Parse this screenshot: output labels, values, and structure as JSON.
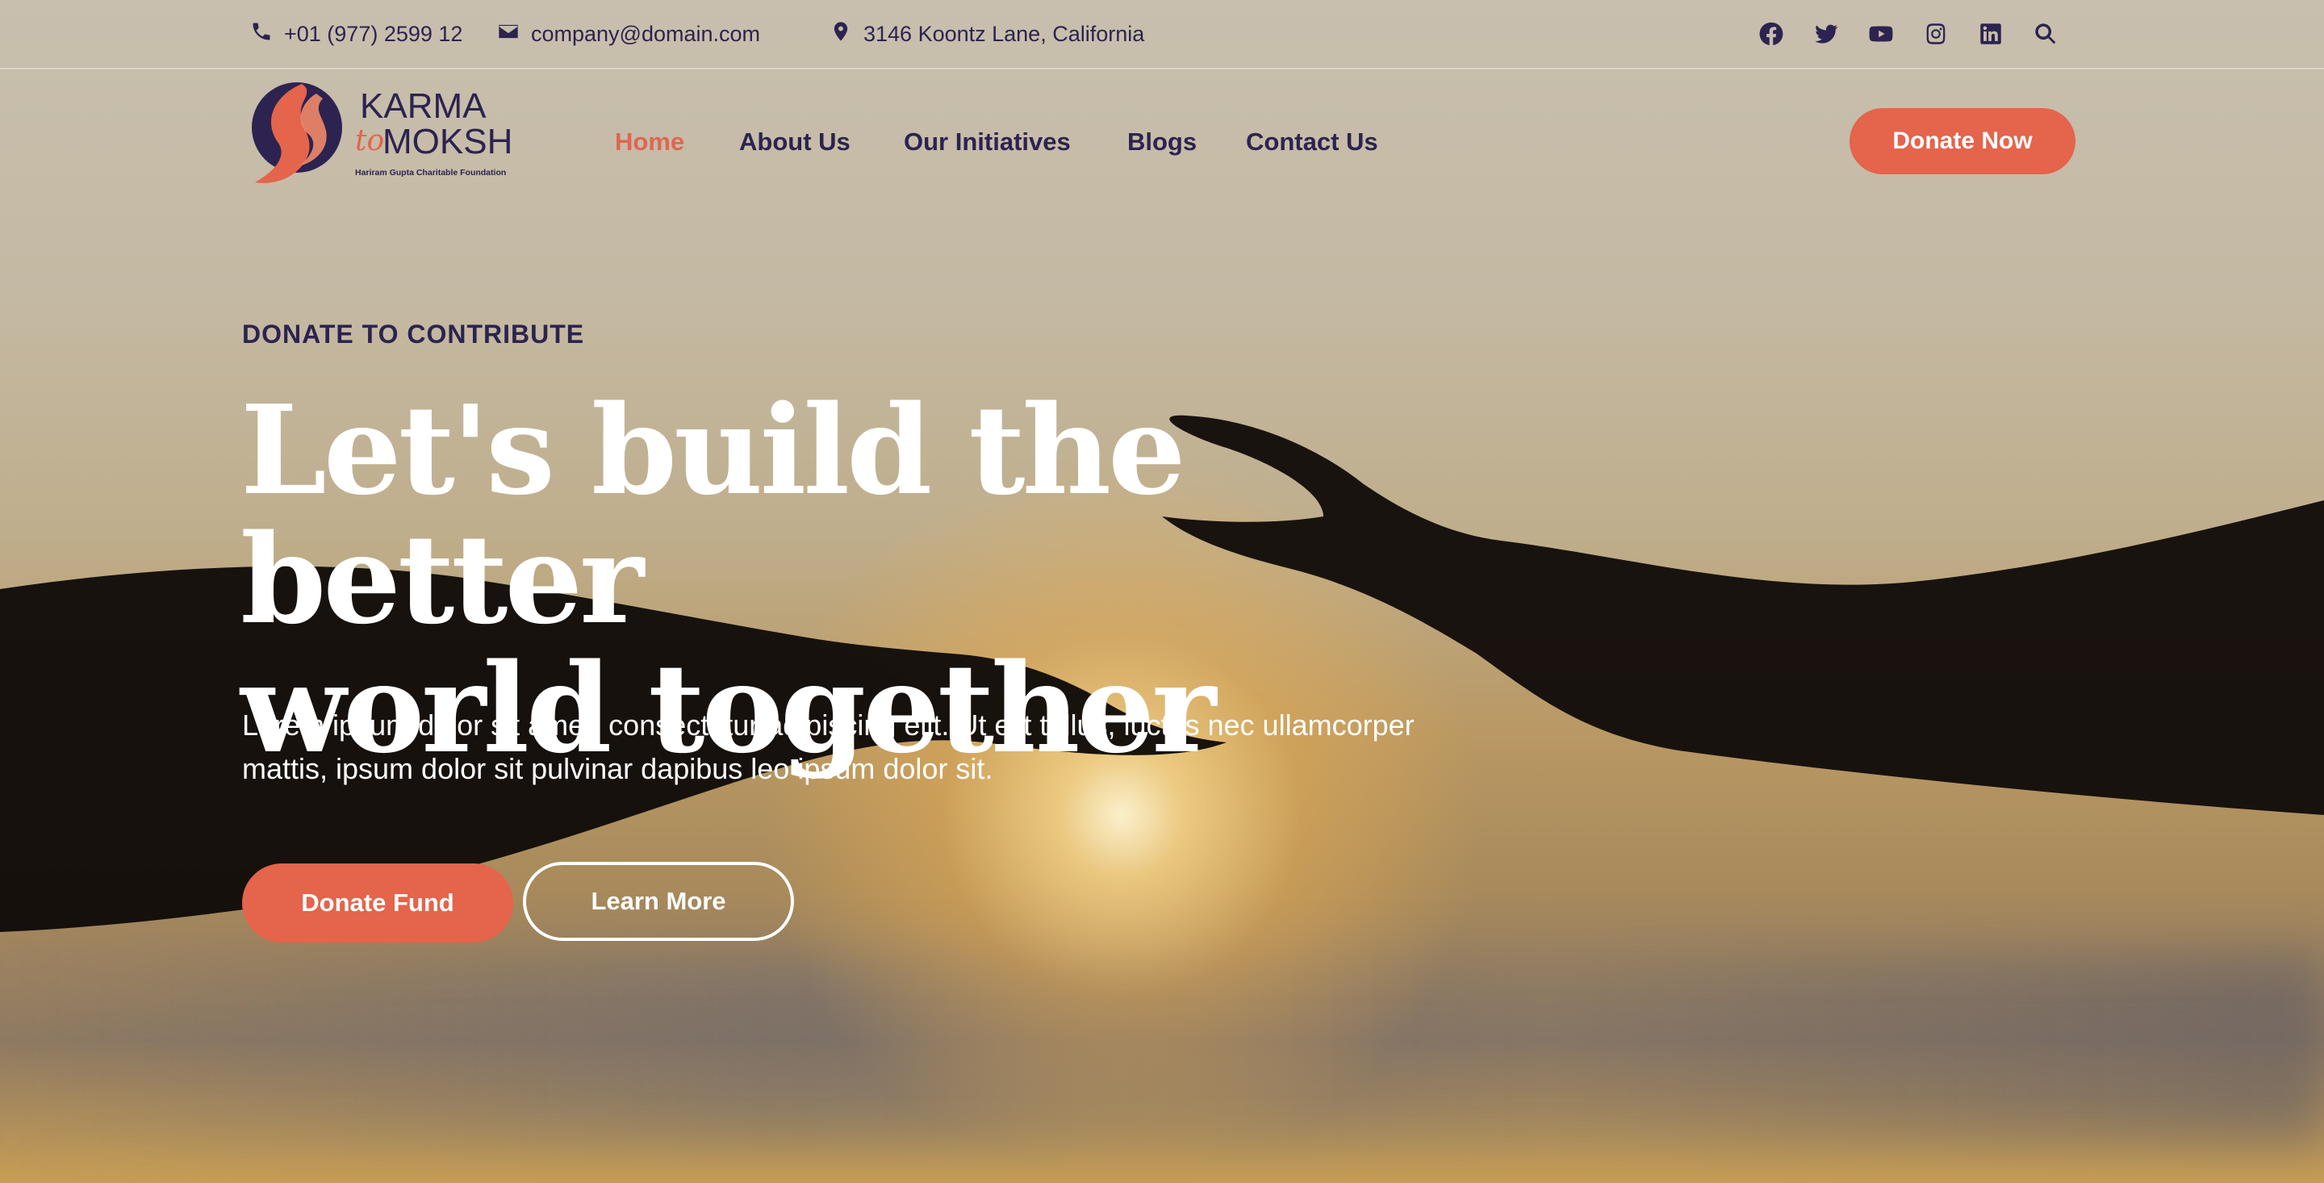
{
  "topbar": {
    "phone": "+01 (977) 2599 12",
    "email": "company@domain.com",
    "address": "3146 Koontz Lane, California"
  },
  "social_icons": [
    "facebook-icon",
    "twitter-icon",
    "youtube-icon",
    "instagram-icon",
    "linkedin-icon",
    "search-icon"
  ],
  "logo": {
    "line1": "KARMA",
    "connector": "to",
    "line2": "MOKSH",
    "tagline": "Hariram Gupta Charitable Foundation"
  },
  "nav": {
    "items": [
      {
        "label": "Home",
        "active": true
      },
      {
        "label": "About Us",
        "active": false
      },
      {
        "label": "Our Initiatives",
        "active": false
      },
      {
        "label": "Blogs",
        "active": false
      },
      {
        "label": "Contact Us",
        "active": false
      }
    ],
    "donate_label": "Donate Now"
  },
  "hero": {
    "eyebrow": "DONATE TO CONTRIBUTE",
    "headline_line1": "Let's build the better",
    "headline_line2": "world together",
    "lead": "Lorem ipsum dolor sit amet, consectetur adipiscing elit. Ut elit tellus, luctus nec ullamcorper mattis, ipsum dolor sit pulvinar dapibus leo ipsum dolor sit.",
    "primary_button": "Donate Fund",
    "secondary_button": "Learn More"
  },
  "colors": {
    "accent": "#e4644c",
    "navy": "#2c2350",
    "white": "#ffffff"
  }
}
